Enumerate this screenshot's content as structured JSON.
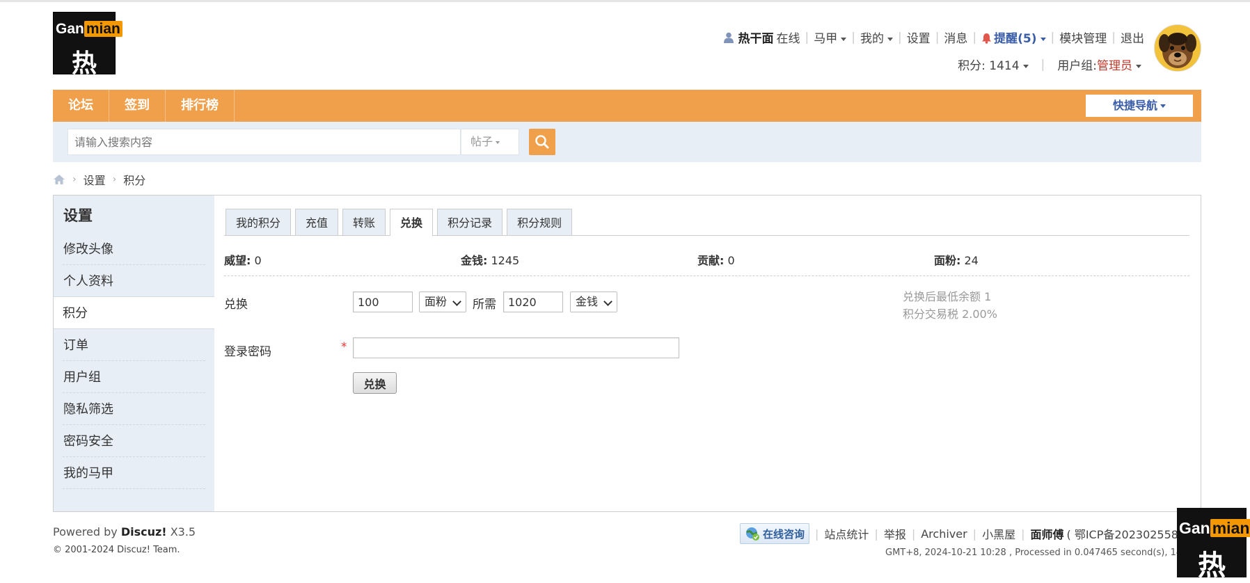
{
  "logo": {
    "text_a": "Gan",
    "text_b": "mian",
    "glyph": "热"
  },
  "user": {
    "name": "热干面",
    "status": "在线",
    "majia": "马甲",
    "mine": "我的",
    "settings": "设置",
    "messages": "消息",
    "remind": "提醒(5)",
    "module_mgmt": "模块管理",
    "logout": "退出",
    "points_label": "积分: 1414",
    "group_label": "用户组: ",
    "group_value": "管理员"
  },
  "nav": {
    "items": [
      "论坛",
      "签到",
      "排行榜"
    ],
    "quick": "快捷导航"
  },
  "search": {
    "placeholder": "请输入搜索内容",
    "type": "帖子"
  },
  "breadcrumb": {
    "settings": "设置",
    "points": "积分"
  },
  "sidebar": {
    "title": "设置",
    "items": [
      "修改头像",
      "个人资料",
      "积分",
      "订单",
      "用户组",
      "隐私筛选",
      "密码安全",
      "我的马甲"
    ]
  },
  "tabs": [
    "我的积分",
    "充值",
    "转账",
    "兑换",
    "积分记录",
    "积分规则"
  ],
  "stats": [
    {
      "label": "威望:",
      "value": "0"
    },
    {
      "label": "金钱:",
      "value": "1245"
    },
    {
      "label": "贡献:",
      "value": "0"
    },
    {
      "label": "面粉:",
      "value": "24"
    }
  ],
  "exchange": {
    "label": "兑换",
    "amount": "100",
    "from_unit": "面粉",
    "need_label": "所需",
    "need_amount": "1020",
    "to_unit": "金钱",
    "note1": "兑换后最低余额 1",
    "note2": "积分交易税 2.00%",
    "password_label": "登录密码",
    "required_mark": "*",
    "submit": "兑换"
  },
  "footer": {
    "powered_prefix": "Powered by ",
    "powered_brand": "Discuz!",
    "powered_version": " X3.5",
    "copyright": "© 2001-2024 Discuz! Team.",
    "consult": "在线咨询",
    "links": [
      "站点统计",
      "举报",
      "Archiver",
      "小黑屋"
    ],
    "site_name": "面师傅",
    "icp": "( 鄂ICP备202302558",
    "gmt": "GMT+8, 2024-10-21 10:28 , Processed in 0.047465 second(s), 14 que"
  },
  "colors": {
    "nav": "#f0a04b",
    "accent_blue": "#3a5da8",
    "admin_red": "#c0392b"
  }
}
